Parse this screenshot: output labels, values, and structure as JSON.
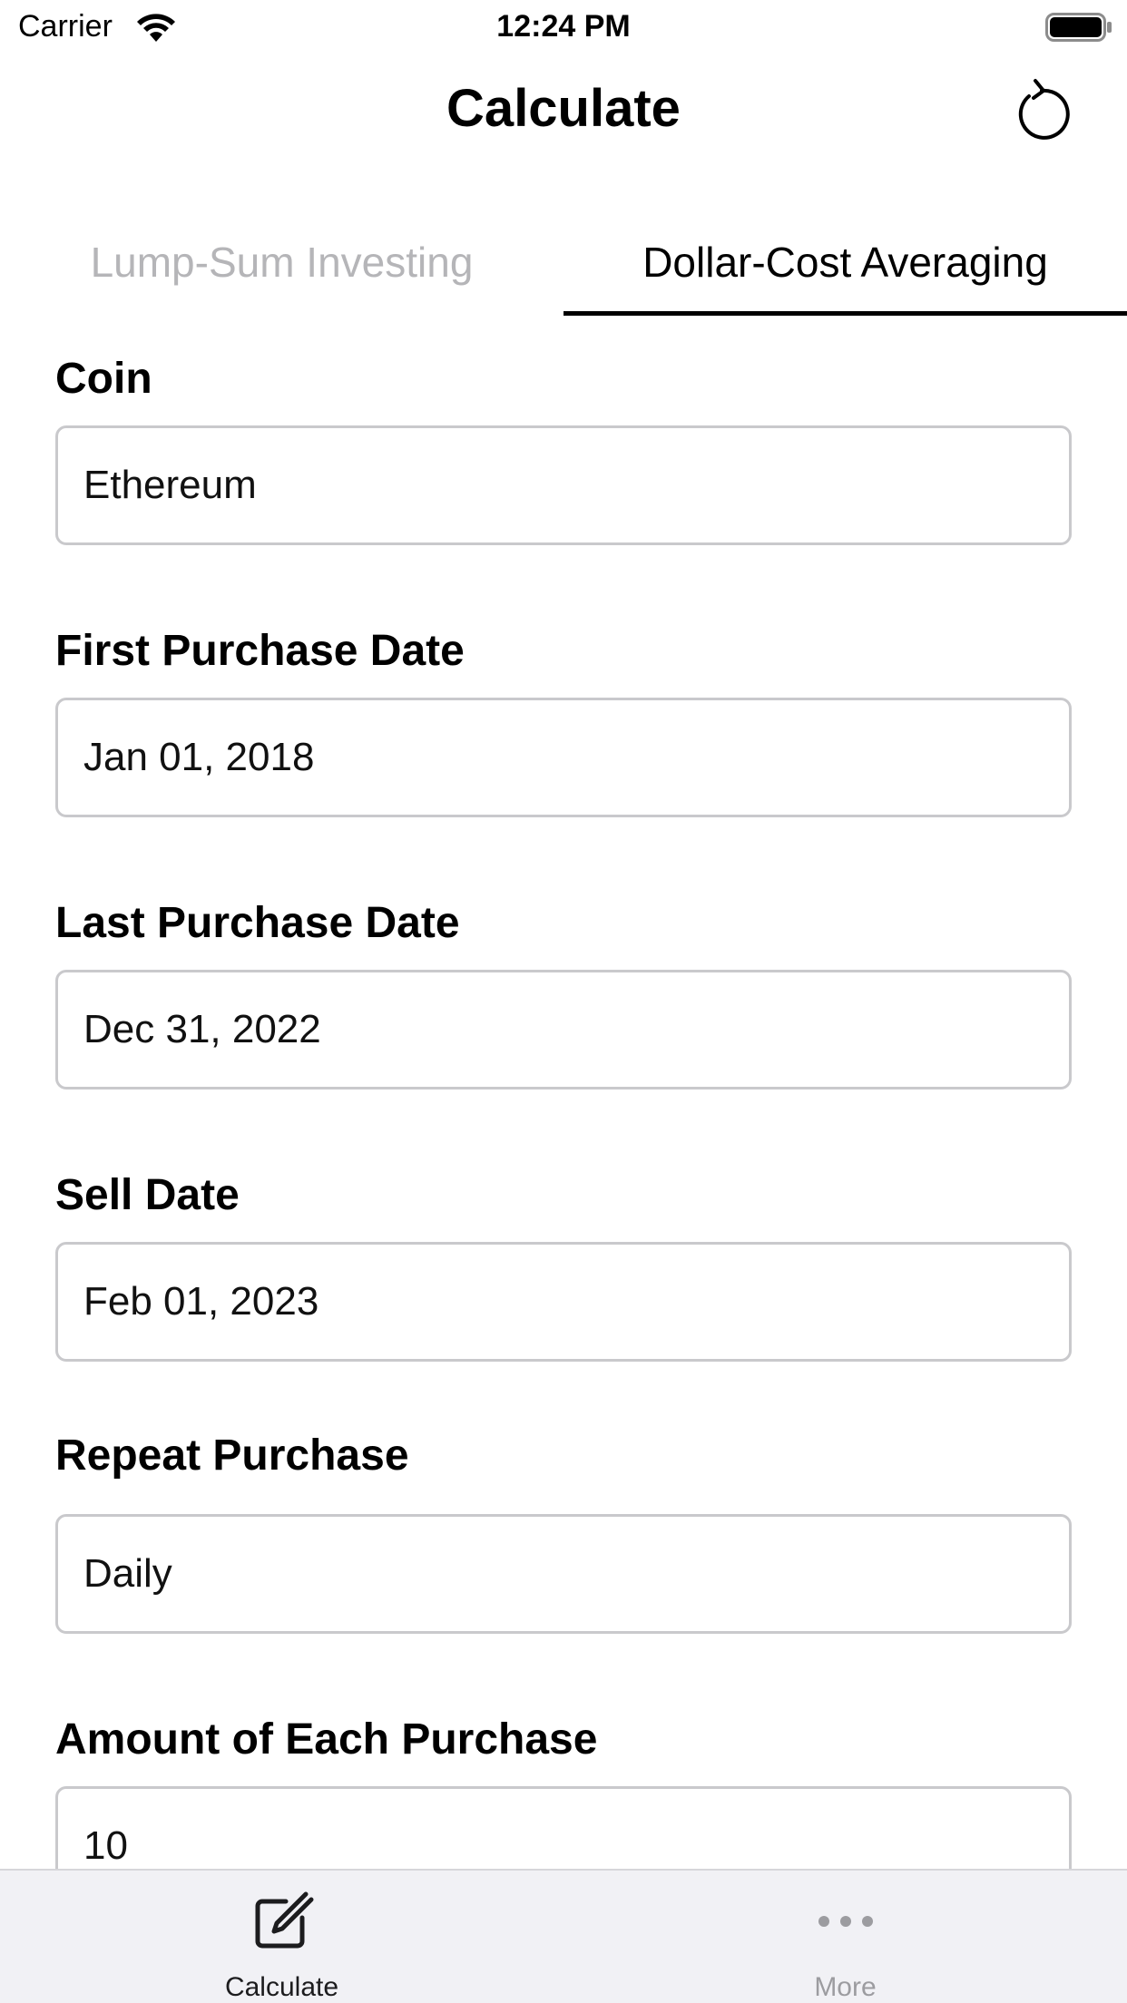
{
  "status_bar": {
    "carrier": "Carrier",
    "time": "12:24 PM",
    "wifi_icon": "wifi-icon",
    "battery_icon": "battery-full-icon"
  },
  "nav": {
    "title": "Calculate",
    "reset_icon": "reset-rotate-icon"
  },
  "tabs": [
    {
      "label": "Lump-Sum Investing",
      "selected": false
    },
    {
      "label": "Dollar-Cost Averaging",
      "selected": true
    }
  ],
  "form": {
    "coin": {
      "label": "Coin",
      "value": "Ethereum"
    },
    "first_purchase_date": {
      "label": "First Purchase Date",
      "value": "Jan 01, 2018"
    },
    "last_purchase_date": {
      "label": "Last Purchase Date",
      "value": "Dec 31, 2022"
    },
    "sell_date": {
      "label": "Sell Date",
      "value": "Feb 01, 2023"
    },
    "repeat_purchase": {
      "label": "Repeat Purchase",
      "value": "Daily"
    },
    "amount_each_purchase": {
      "label": "Amount of Each Purchase",
      "value": "10"
    }
  },
  "tab_bar": {
    "items": [
      {
        "label": "Calculate",
        "icon": "square-pencil-icon",
        "selected": true
      },
      {
        "label": "More",
        "icon": "ellipsis-icon",
        "selected": false
      }
    ]
  },
  "colors": {
    "active_text": "#000000",
    "inactive_tab_text": "#b5b5b8",
    "input_border": "#c9c9cc",
    "tab_bar_bg": "#f1f1f5",
    "tab_bar_inactive": "#9c9ca0"
  }
}
